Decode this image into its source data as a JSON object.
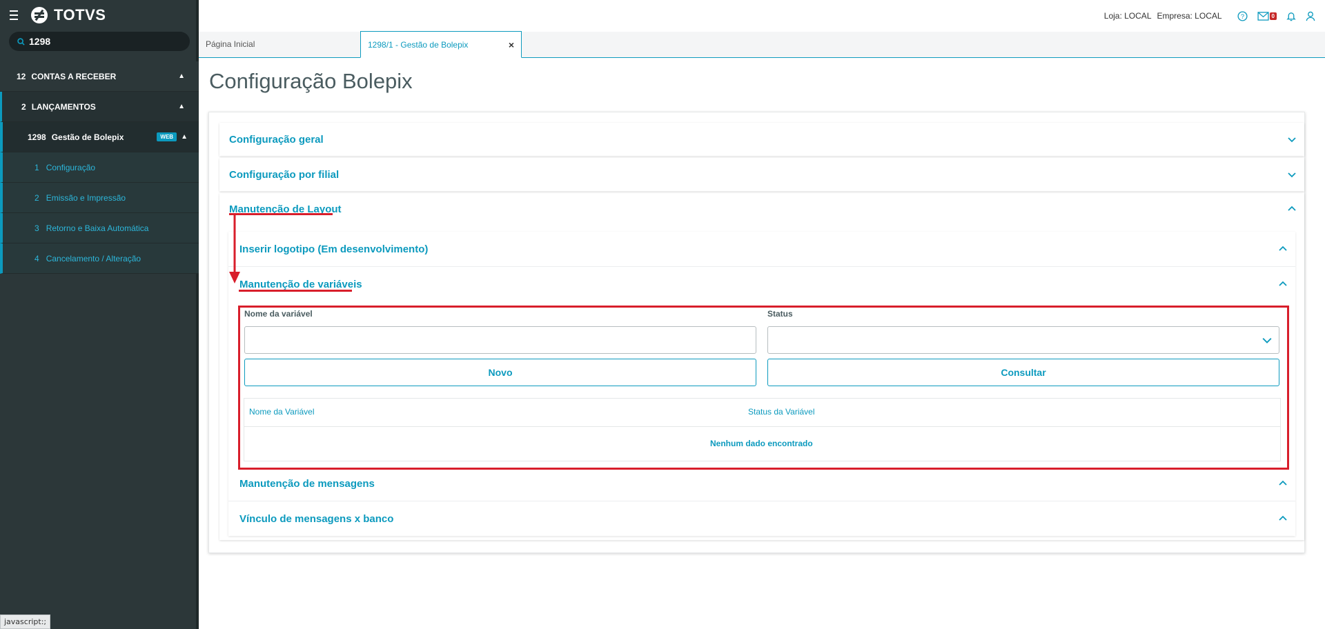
{
  "sidebar": {
    "logo_text": "TOTVS",
    "search_value": "1298",
    "items": [
      {
        "num": "12",
        "label": "CONTAS A RECEBER"
      },
      {
        "num": "2",
        "label": "LANÇAMENTOS"
      },
      {
        "num": "1298",
        "label": "Gestão de Bolepix",
        "badge": "WEB"
      },
      {
        "num": "1",
        "label": "Configuração"
      },
      {
        "num": "2",
        "label": "Emissão e Impressão"
      },
      {
        "num": "3",
        "label": "Retorno e Baixa Automática"
      },
      {
        "num": "4",
        "label": "Cancelamento / Alteração"
      }
    ],
    "status_text": "javascript:;"
  },
  "header": {
    "loja": "Loja: LOCAL",
    "empresa": "Empresa: LOCAL",
    "mail_count": "0"
  },
  "tabs": [
    {
      "label": "Página Inicial"
    },
    {
      "label": "1298/1 - Gestão de Bolepix",
      "close": "×"
    }
  ],
  "page": {
    "title": "Configuração Bolepix",
    "sections": {
      "geral": "Configuração geral",
      "filial": "Configuração por filial",
      "layout": "Manutenção de Layout"
    },
    "subsections": {
      "logotipo": "Inserir logotipo (Em desenvolvimento)",
      "variaveis": "Manutenção de variáveis",
      "mensagens": "Manutenção de mensagens",
      "vinculo": "Vínculo de mensagens x banco"
    },
    "form": {
      "nome_label": "Nome da variável",
      "nome_value": "",
      "status_label": "Status",
      "status_value": "",
      "novo_button": "Novo",
      "consultar_button": "Consultar"
    },
    "table": {
      "columns": [
        "Nome da Variável",
        "Status da Variável"
      ],
      "empty_message": "Nenhum dado encontrado"
    }
  },
  "colors": {
    "accent": "#0c9abe",
    "sidebar_bg": "#2c3739",
    "highlight_red": "#d81e2b"
  }
}
